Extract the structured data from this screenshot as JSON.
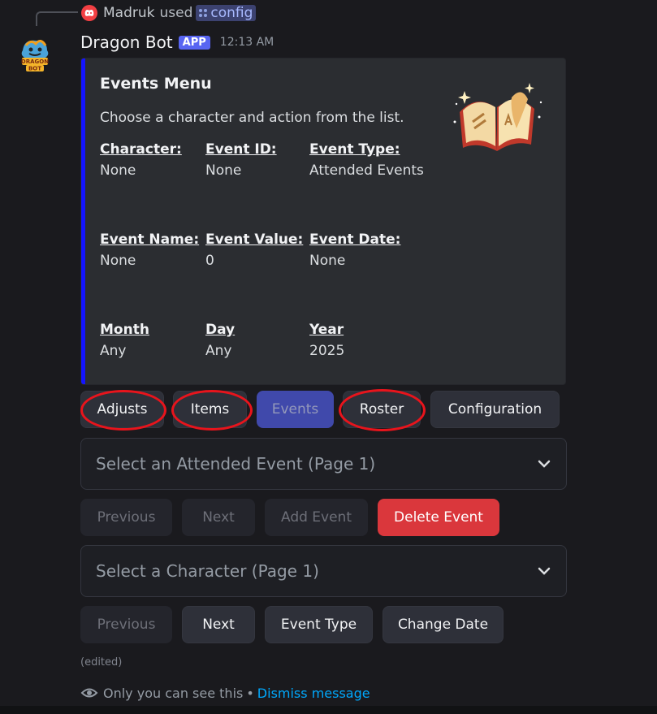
{
  "reply": {
    "user": "Madruk",
    "used_text": "used",
    "command": "config"
  },
  "message": {
    "bot_name": "Dragon Bot",
    "app_badge": "APP",
    "time": "12:13 AM"
  },
  "embed": {
    "accent_color": "#1414ff",
    "title": "Events Menu",
    "description": "Choose a character and action from the list.",
    "fields": [
      {
        "name": "Character:",
        "value": "None"
      },
      {
        "name": "Event ID:",
        "value": "None"
      },
      {
        "name": "Event Type:",
        "value": "Attended Events"
      },
      {
        "name": "Event Name:",
        "value": "None"
      },
      {
        "name": "Event Value:",
        "value": "0"
      },
      {
        "name": "Event Date:",
        "value": "None"
      },
      {
        "name": "Month",
        "value": "Any"
      },
      {
        "name": "Day",
        "value": "Any"
      },
      {
        "name": "Year",
        "value": "2025"
      }
    ],
    "thumbnail_icon": "open-spellbook-icon"
  },
  "nav_buttons": [
    "Adjusts",
    "Items",
    "Events",
    "Roster",
    "Configuration"
  ],
  "event_select": {
    "placeholder": "Select an Attended Event (Page 1)"
  },
  "event_buttons": [
    "Previous",
    "Next",
    "Add Event",
    "Delete Event"
  ],
  "character_select": {
    "placeholder": "Select a Character (Page 1)"
  },
  "character_buttons": [
    "Previous",
    "Next",
    "Event Type",
    "Change Date"
  ],
  "edited_label": "(edited)",
  "ephemeral": {
    "text": "Only you can see this",
    "separator": "•",
    "dismiss": "Dismiss message"
  },
  "colors": {
    "background": "#1a1a1e",
    "embed_bg": "#2b2d31",
    "blurple": "#5865f2",
    "danger": "#da373c",
    "annotation_ring": "#e8141c"
  }
}
